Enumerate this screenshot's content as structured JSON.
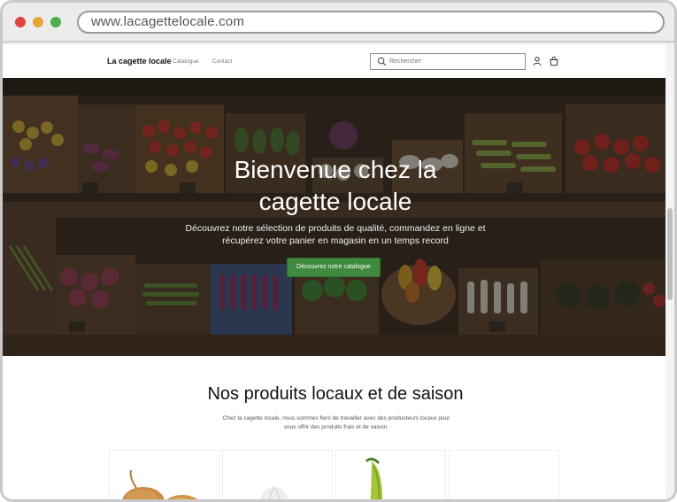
{
  "browser": {
    "url": "www.lacagettelocale.com"
  },
  "nav": {
    "brand": "La cagette locale",
    "links": [
      "Catalogue",
      "Contact"
    ],
    "search_placeholder": "Rechercher",
    "icons": [
      "search-icon",
      "account-icon",
      "cart-icon"
    ]
  },
  "hero": {
    "title_line1": "Bienvenue chez la",
    "title_line2": "cagette locale",
    "subtitle": "Découvrez notre sélection de produits de qualité, commandez en ligne et récupérez votre panier en magasin en un temps record",
    "cta_label": "Découvrez notre catalogue"
  },
  "products": {
    "title": "Nos produits locaux et de saison",
    "description": "Chez la cagette locale, nous sommes fiers de travailler avec des producteurs locaux pour vous offrir des produits frais et de saison.",
    "cards": [
      "onions",
      "garlic",
      "green-beans",
      "empty"
    ]
  },
  "colors": {
    "accent": "#3f8a3f",
    "window_chrome": "#ececec"
  }
}
